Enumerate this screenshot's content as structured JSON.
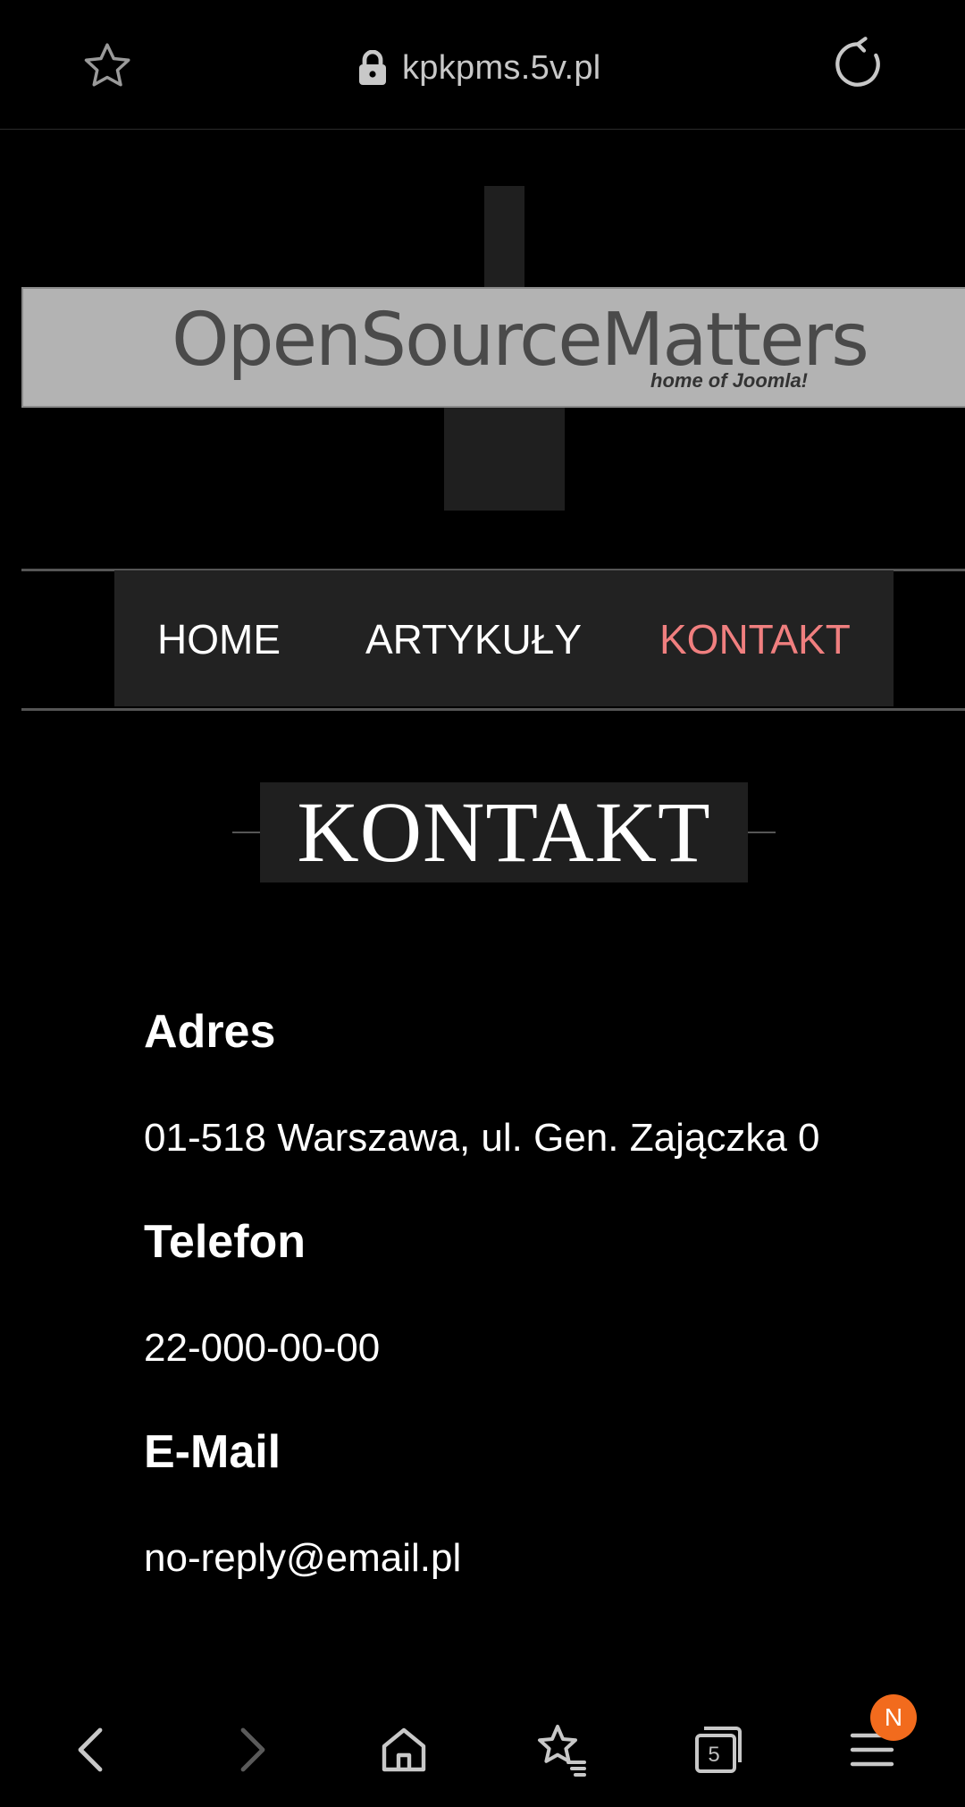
{
  "browser": {
    "url": "kpkpms.5v.pl",
    "tabs_count": "5",
    "notification_badge": "N",
    "badge_color": "#f26b1d",
    "icons": {
      "bookmark": "star-icon",
      "lock": "lock-icon",
      "reload": "reload-icon",
      "back": "back-arrow-icon",
      "forward": "forward-arrow-icon",
      "home": "home-icon",
      "bookmarks": "bookmarks-icon",
      "tabs": "tabs-icon",
      "menu": "menu-icon"
    }
  },
  "site": {
    "logo": {
      "main": "OpenSourceMatters",
      "sub": "home of Joomla!"
    },
    "nav": {
      "items": [
        {
          "label": "HOME"
        },
        {
          "label": "ARTYKUŁY"
        },
        {
          "label": "KONTAKT",
          "active": true
        }
      ],
      "active_color": "#f07f7f"
    },
    "page_title": "KONTAKT",
    "contact": {
      "address_label": "Adres",
      "address_value": "01-518 Warszawa, ul. Gen. Zajączka 0",
      "phone_label": "Telefon",
      "phone_value": "22-000-00-00",
      "email_label": "E-Mail",
      "email_value": "no-reply@email.pl"
    }
  }
}
